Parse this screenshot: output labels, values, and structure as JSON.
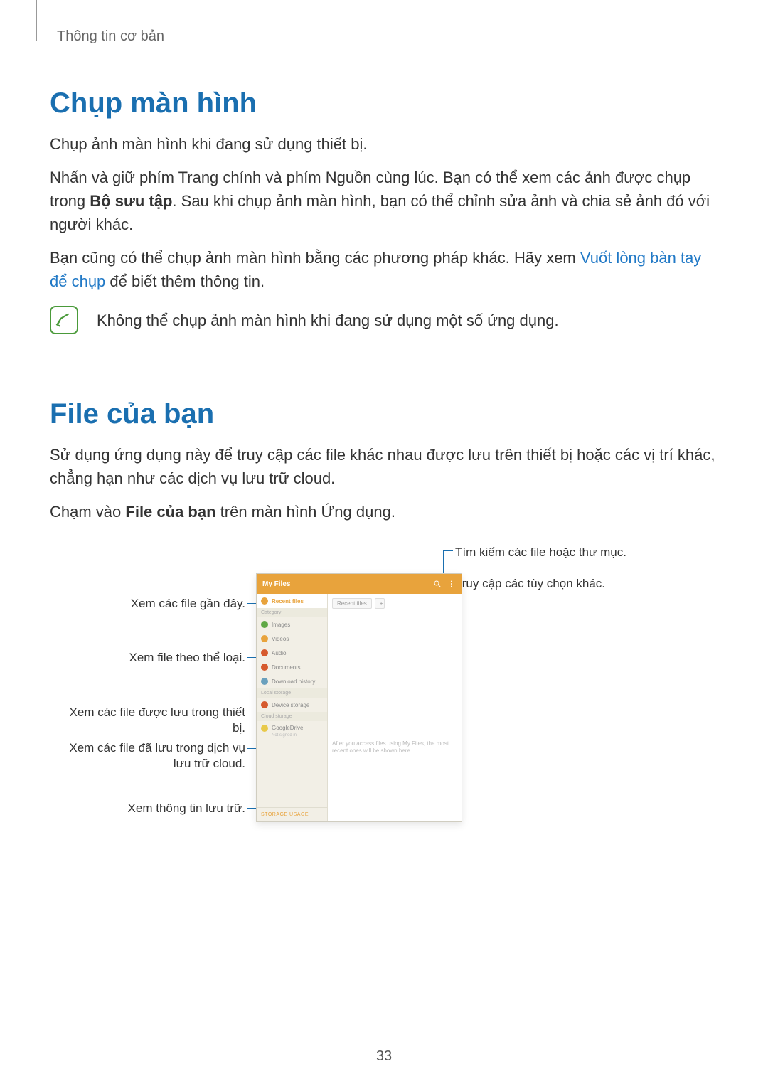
{
  "breadcrumb": "Thông tin cơ bản",
  "section1": {
    "title": "Chụp màn hình",
    "p1": "Chụp ảnh màn hình khi đang sử dụng thiết bị.",
    "p2_pre": "Nhấn và giữ phím Trang chính và phím Nguồn cùng lúc. Bạn có thể xem các ảnh được chụp trong ",
    "p2_bold": "Bộ sưu tập",
    "p2_post": ". Sau khi chụp ảnh màn hình, bạn có thể chỉnh sửa ảnh và chia sẻ ảnh đó với người khác.",
    "p3_pre": "Bạn cũng có thể chụp ảnh màn hình bằng các phương pháp khác. Hãy xem ",
    "p3_link": "Vuốt lòng bàn tay để chụp",
    "p3_post": " để biết thêm thông tin.",
    "note": "Không thể chụp ảnh màn hình khi đang sử dụng một số ứng dụng."
  },
  "section2": {
    "title": "File của bạn",
    "p1": "Sử dụng ứng dụng này để truy cập các file khác nhau được lưu trên thiết bị hoặc các vị trí khác, chẳng hạn như các dịch vụ lưu trữ cloud.",
    "p2_pre": "Chạm vào ",
    "p2_bold": "File của bạn",
    "p2_post": " trên màn hình Ứng dụng."
  },
  "callouts": {
    "left1": "Xem các file gần đây.",
    "left2": "Xem file theo thể loại.",
    "left3": "Xem các file được lưu trong thiết bị.",
    "left4": "Xem các file đã lưu trong dịch vụ lưu trữ cloud.",
    "left5": "Xem thông tin lưu trữ.",
    "right1": "Tìm kiếm các file hoặc thư mục.",
    "right2": "Truy cập các tùy chọn khác."
  },
  "device": {
    "title": "My Files",
    "recent": "Recent files",
    "category": "Category",
    "images": "Images",
    "videos": "Videos",
    "audio": "Audio",
    "documents": "Documents",
    "download": "Download history",
    "local": "Local storage",
    "device_storage": "Device storage",
    "cloud": "Cloud storage",
    "googledrive": "GoogleDrive",
    "googledrive_sub": "Not signed in",
    "storage_usage": "STORAGE USAGE",
    "tab_recent": "Recent files",
    "tab_plus": "+",
    "placeholder": "After you access files using My Files, the most recent ones will be shown here."
  },
  "page_number": "33"
}
